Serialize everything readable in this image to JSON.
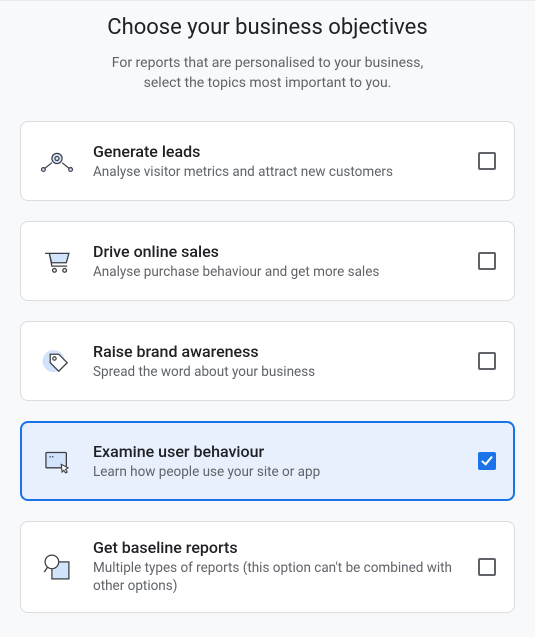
{
  "header": {
    "title": "Choose your business objectives",
    "subtitle_line1": "For reports that are personalised to your business,",
    "subtitle_line2": "select the topics most important to you."
  },
  "options": [
    {
      "id": "generate-leads",
      "title": "Generate leads",
      "desc": "Analyse visitor metrics and attract new customers",
      "checked": false,
      "icon": "people-compass"
    },
    {
      "id": "drive-online-sales",
      "title": "Drive online sales",
      "desc": "Analyse purchase behaviour and get more sales",
      "checked": false,
      "icon": "cart"
    },
    {
      "id": "raise-brand-awareness",
      "title": "Raise brand awareness",
      "desc": "Spread the word about your business",
      "checked": false,
      "icon": "tag"
    },
    {
      "id": "examine-user-behaviour",
      "title": "Examine user behaviour",
      "desc": "Learn how people use your site or app",
      "checked": true,
      "icon": "screen-cursor"
    },
    {
      "id": "get-baseline-reports",
      "title": "Get baseline reports",
      "desc": "Multiple types of reports (this option can't be combined with other options)",
      "checked": false,
      "icon": "report-magnify"
    }
  ],
  "colors": {
    "accent": "#1a73e8",
    "selected_bg": "#e8f0fe",
    "icon_fill": "#d2e3fc",
    "icon_stroke": "#3c4043"
  }
}
